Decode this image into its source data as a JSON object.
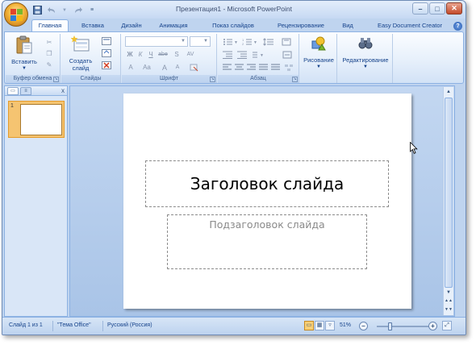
{
  "window": {
    "title": "Презентация1 - Microsoft PowerPoint",
    "controls": {
      "minimize": "–",
      "maximize": "□",
      "close": "✕"
    }
  },
  "quick_access": {
    "save_icon": "floppy-disk-icon",
    "undo_icon": "undo-arrow-icon",
    "redo_icon": "redo-arrow-icon",
    "customize_icon": "dropdown-icon"
  },
  "tabs": [
    {
      "label": "Главная",
      "active": true
    },
    {
      "label": "Вставка",
      "active": false
    },
    {
      "label": "Дизайн",
      "active": false
    },
    {
      "label": "Анимация",
      "active": false
    },
    {
      "label": "Показ слайдов",
      "active": false
    },
    {
      "label": "Рецензирование",
      "active": false
    },
    {
      "label": "Вид",
      "active": false
    },
    {
      "label": "Easy Document Creator",
      "active": false
    }
  ],
  "ribbon": {
    "clipboard": {
      "paste_label": "Вставить",
      "group_label": "Буфер обмена"
    },
    "slides": {
      "new_slide_label_1": "Создать",
      "new_slide_label_2": "слайд",
      "group_label": "Слайды"
    },
    "font": {
      "group_label": "Шрифт",
      "bold": "Ж",
      "italic": "К",
      "underline": "Ч",
      "strike": "abe",
      "shadow": "S",
      "spacing": "AV",
      "change_case": "Aa",
      "grow": "A",
      "shrink": "A",
      "clear": "A"
    },
    "paragraph": {
      "group_label": "Абзац"
    },
    "drawing": {
      "label": "Рисование"
    },
    "editing": {
      "label": "Редактирование"
    }
  },
  "slides_pane": {
    "thumbnail_number": "1",
    "close": "x"
  },
  "slide": {
    "title_placeholder": "Заголовок слайда",
    "subtitle_placeholder": "Подзаголовок слайда"
  },
  "status_bar": {
    "slide_info": "Слайд 1 из 1",
    "theme": "\"Тема Office\"",
    "language": "Русский (Россия)",
    "zoom": "51%",
    "zoom_fraction": 0.51
  }
}
